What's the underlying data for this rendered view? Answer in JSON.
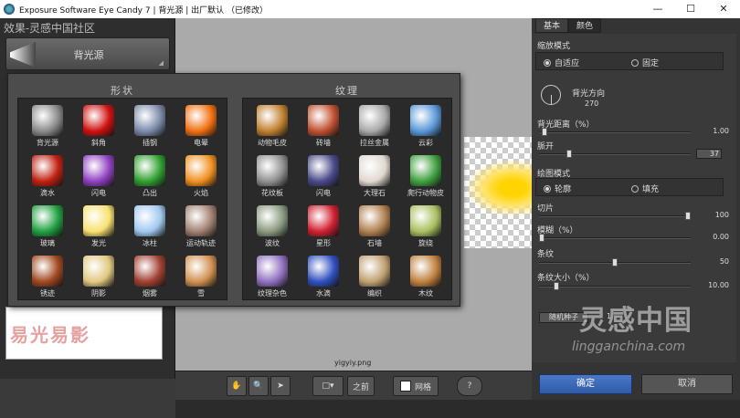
{
  "window": {
    "title": "Exposure Software Eye Candy 7 | 背光源 | 出厂默认 （已修改）",
    "min": "—",
    "max": "☐",
    "close": "✕"
  },
  "left": {
    "effect_header": "效果-灵感中国社区",
    "effect_name": "背光源",
    "thumbnail_text": "易光易影"
  },
  "popup": {
    "shapes_title": "形状",
    "textures_title": "纹理",
    "shapes": [
      {
        "label": "背光源",
        "color": "#8a8a8a"
      },
      {
        "label": "斜角",
        "color": "#d01010"
      },
      {
        "label": "插钢",
        "color": "#7a8aa8"
      },
      {
        "label": "电晕",
        "color": "#f07010"
      },
      {
        "label": "滴水",
        "color": "#c02010"
      },
      {
        "label": "闪电",
        "color": "#9040c0"
      },
      {
        "label": "凸出",
        "color": "#30a030"
      },
      {
        "label": "火焰",
        "color": "#f09020"
      },
      {
        "label": "玻璃",
        "color": "#20a040"
      },
      {
        "label": "发光",
        "color": "#f8e070"
      },
      {
        "label": "冰柱",
        "color": "#a0c8f0"
      },
      {
        "label": "运动轨迹",
        "color": "#a08070"
      },
      {
        "label": "锈迹",
        "color": "#a04820"
      },
      {
        "label": "阴影",
        "color": "#e0c880"
      },
      {
        "label": "烟雾",
        "color": "#a04030"
      },
      {
        "label": "雪",
        "color": "#d09050"
      }
    ],
    "textures": [
      {
        "label": "动物毛皮",
        "color": "#c08030"
      },
      {
        "label": "砖墙",
        "color": "#c05030"
      },
      {
        "label": "拉丝金属",
        "color": "#a8a8a8"
      },
      {
        "label": "云彩",
        "color": "#5a98d8"
      },
      {
        "label": "花纹板",
        "color": "#909090"
      },
      {
        "label": "闪电",
        "color": "#4a4a8a"
      },
      {
        "label": "大理石",
        "color": "#e0d8d0"
      },
      {
        "label": "爬行动物皮",
        "color": "#40a040"
      },
      {
        "label": "波纹",
        "color": "#8a9a80"
      },
      {
        "label": "星形",
        "color": "#d02030"
      },
      {
        "label": "石墙",
        "color": "#b08050"
      },
      {
        "label": "旋绕",
        "color": "#a8c060"
      },
      {
        "label": "纹理杂色",
        "color": "#9070c0"
      },
      {
        "label": "水滴",
        "color": "#3050c0"
      },
      {
        "label": "编织",
        "color": "#c0a070"
      },
      {
        "label": "木纹",
        "color": "#c08040"
      }
    ]
  },
  "canvas": {
    "filename": "yigyiy.png"
  },
  "bottombar": {
    "hand": "✋",
    "zoom": "🔍",
    "arrow": "➤",
    "before_label": "之前",
    "grid_label": "网格",
    "help": "?"
  },
  "right": {
    "tabs": [
      "基本",
      "颜色"
    ],
    "scale_mode_label": "缩放模式",
    "scale_options": [
      "自适应",
      "固定"
    ],
    "direction_label": "背光方向",
    "direction_value": "270",
    "distance_label": "背光距离（%）",
    "distance_value": "1.00",
    "distance_fraction": 0.02,
    "bevel_label": "脈开",
    "bevel_value": "37",
    "bevel_fraction": 0.19,
    "draw_mode_label": "绘图模式",
    "draw_options": [
      "轮廓",
      "填充"
    ],
    "slices_label": "切片",
    "slices_value": "100",
    "slices_fraction": 1.0,
    "blur_label": "模糊（%）",
    "blur_value": "0.00",
    "blur_fraction": 0.0,
    "stripes_label": "条纹",
    "stripes_value": "50",
    "stripes_fraction": 0.5,
    "stripe_size_label": "条纹大小（%）",
    "stripe_size_value": "10.00",
    "stripe_size_fraction": 0.1,
    "seed_button": "随机种子",
    "seed_value": "1",
    "ok": "确定",
    "cancel": "取消",
    "watermark_big": "灵感中国",
    "watermark_small": "lingganchina.com"
  }
}
